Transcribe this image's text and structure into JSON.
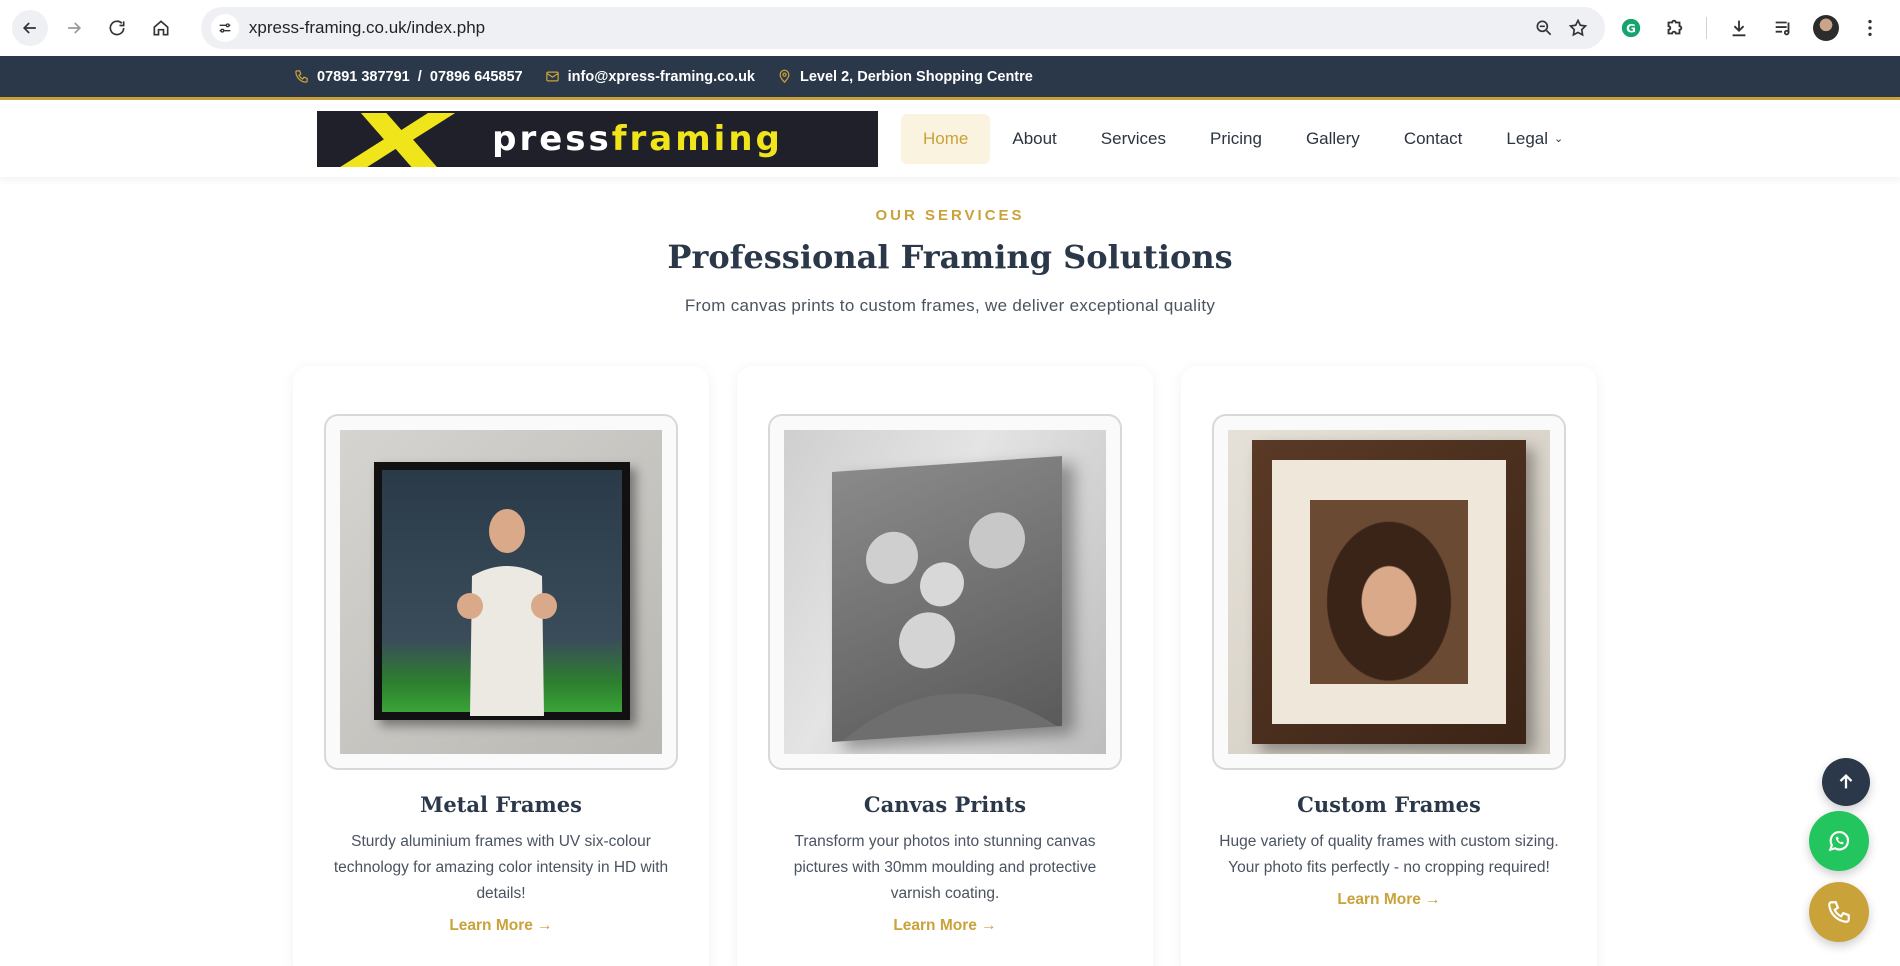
{
  "browser": {
    "url": "xpress-framing.co.uk/index.php"
  },
  "topbar": {
    "phone": "07891 387791  /  07896 645857",
    "email": "info@xpress-framing.co.uk",
    "location": "Level 2, Derbion Shopping Centre"
  },
  "logo": {
    "part1": "press",
    "part2": "framing",
    "initial": "X"
  },
  "nav": {
    "items": [
      {
        "label": "Home",
        "active": true
      },
      {
        "label": "About"
      },
      {
        "label": "Services"
      },
      {
        "label": "Pricing"
      },
      {
        "label": "Gallery"
      },
      {
        "label": "Contact"
      },
      {
        "label": "Legal"
      }
    ]
  },
  "services": {
    "eyebrow": "OUR SERVICES",
    "title": "Professional Framing Solutions",
    "subtitle": "From canvas prints to custom frames, we deliver exceptional quality",
    "cards": [
      {
        "title": "Metal Frames",
        "text": "Sturdy aluminium frames with UV six-colour technology for amazing color intensity in HD with details!",
        "link": "Learn More →"
      },
      {
        "title": "Canvas Prints",
        "text": "Transform your photos into stunning canvas pictures with 30mm moulding and protective varnish coating.",
        "link": "Learn More →"
      },
      {
        "title": "Custom Frames",
        "text": "Huge variety of quality frames with custom sizing. Your photo fits perfectly - no cropping required!",
        "link": "Learn More →"
      }
    ]
  },
  "colors": {
    "accent": "#c9a23a",
    "navy": "#2a3849",
    "whatsapp": "#22c55e"
  }
}
